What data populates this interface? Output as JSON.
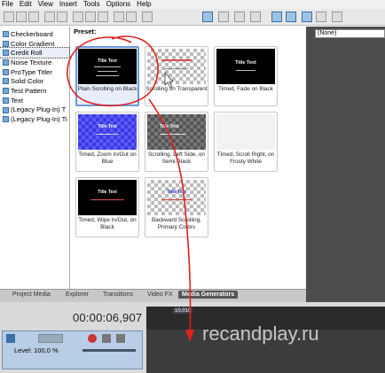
{
  "menu": [
    "File",
    "Edit",
    "View",
    "Insert",
    "Tools",
    "Options",
    "Help"
  ],
  "sidebar": {
    "items": [
      {
        "label": "Checkerboard"
      },
      {
        "label": "Color Gradient"
      },
      {
        "label": "Credit Roll",
        "selected": true
      },
      {
        "label": "Noise Texture"
      },
      {
        "label": "ProType Titler"
      },
      {
        "label": "Solid Color"
      },
      {
        "label": "Test Pattern"
      },
      {
        "label": "Text"
      },
      {
        "label": "(Legacy Plug-In) T"
      },
      {
        "label": "(Legacy Plug-In) Ti"
      }
    ]
  },
  "preset": {
    "label": "Preset:",
    "items": [
      {
        "caption": "Plain Scrolling on Black",
        "thumb_title": "Title Text",
        "style": "black",
        "selected": true
      },
      {
        "caption": "Scrolling on Transparent",
        "thumb_title": "",
        "style": "checker"
      },
      {
        "caption": "Timed, Fade on Black",
        "thumb_title": "Title Text",
        "style": "black"
      },
      {
        "caption": "",
        "thumb_title": "",
        "style": "frost"
      },
      {
        "caption": "Timed, Zoom In/Out on Blue",
        "thumb_title": "Title Text",
        "style": "blue"
      },
      {
        "caption": "Scrolling, Left Side, on Semi-Black",
        "thumb_title": "Title Text",
        "style": "semi"
      },
      {
        "caption": "Timed, Scroll Right, on Frosty White",
        "thumb_title": "",
        "style": "frost"
      },
      {
        "caption": "",
        "thumb_title": "",
        "style": "frost"
      },
      {
        "caption": "Timed, Wipe In/Out, on Black",
        "thumb_title": "Title Text",
        "style": "black"
      },
      {
        "caption": "Backward Scrolling, Primary Colors",
        "thumb_title": "Title Text",
        "style": "checker"
      }
    ]
  },
  "preview": {
    "select_value": "(None)"
  },
  "tabs": [
    {
      "label": "Project Media"
    },
    {
      "label": "Explorer"
    },
    {
      "label": "Transitions"
    },
    {
      "label": "Video FX"
    },
    {
      "label": "Media Generators",
      "active": true
    }
  ],
  "timeline": {
    "timecode": "00:00:06,907",
    "marker": "10,010",
    "level": "Level: 100,0 %"
  },
  "watermark": "recandplay.ru",
  "colors": {
    "accent": "#6a9ad8",
    "annotation": "#e02020"
  }
}
